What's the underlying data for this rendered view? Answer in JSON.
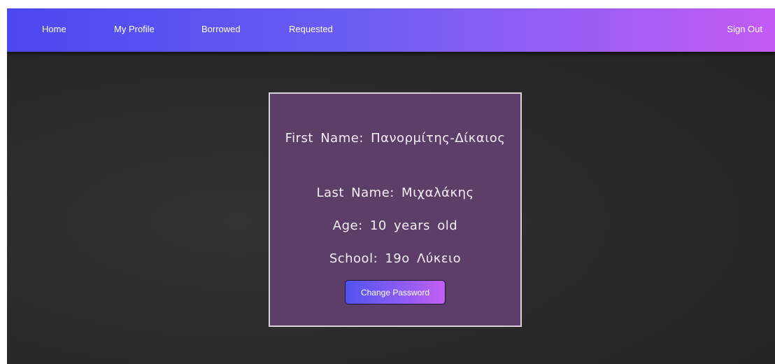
{
  "nav": {
    "home": "Home",
    "my_profile": "My Profile",
    "borrowed": "Borrowed",
    "requested": "Requested",
    "sign_out": "Sign Out"
  },
  "profile": {
    "first_name": "First Name: Πανορμίτης-Δίκαιος",
    "last_name": "Last Name: Μιχαλάκης",
    "age": "Age: 10 years old",
    "school": "School: 19ο Λύκειο",
    "change_password_label": "Change Password"
  },
  "colors": {
    "nav_gradient_start": "#4c47f0",
    "nav_gradient_end": "#c45cf4",
    "card_background": "#5d3e68",
    "page_background": "#2a2a2a"
  }
}
